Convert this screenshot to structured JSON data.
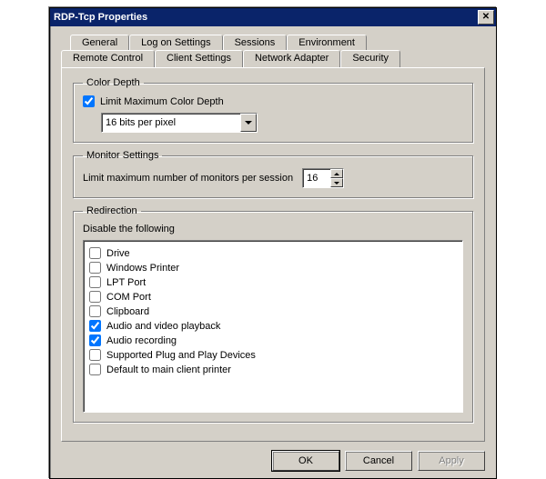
{
  "window": {
    "title": "RDP-Tcp Properties"
  },
  "tabs": {
    "row1": [
      "General",
      "Log on Settings",
      "Sessions",
      "Environment"
    ],
    "row2": [
      "Remote Control",
      "Client Settings",
      "Network Adapter",
      "Security"
    ],
    "active": "Client Settings"
  },
  "color_depth": {
    "legend": "Color Depth",
    "limit_label": "Limit Maximum Color Depth",
    "limit_checked": true,
    "selected": "16 bits per pixel"
  },
  "monitor_settings": {
    "legend": "Monitor Settings",
    "label": "Limit maximum number of monitors per session",
    "value": "16"
  },
  "redirection": {
    "legend": "Redirection",
    "disable_label": "Disable the following",
    "items": [
      {
        "label": "Drive",
        "checked": false
      },
      {
        "label": "Windows Printer",
        "checked": false
      },
      {
        "label": "LPT Port",
        "checked": false
      },
      {
        "label": "COM Port",
        "checked": false
      },
      {
        "label": "Clipboard",
        "checked": false
      },
      {
        "label": "Audio and video playback",
        "checked": true
      },
      {
        "label": "Audio recording",
        "checked": true
      },
      {
        "label": "Supported Plug and Play Devices",
        "checked": false
      },
      {
        "label": "Default to main client printer",
        "checked": false
      }
    ]
  },
  "buttons": {
    "ok": "OK",
    "cancel": "Cancel",
    "apply": "Apply"
  }
}
